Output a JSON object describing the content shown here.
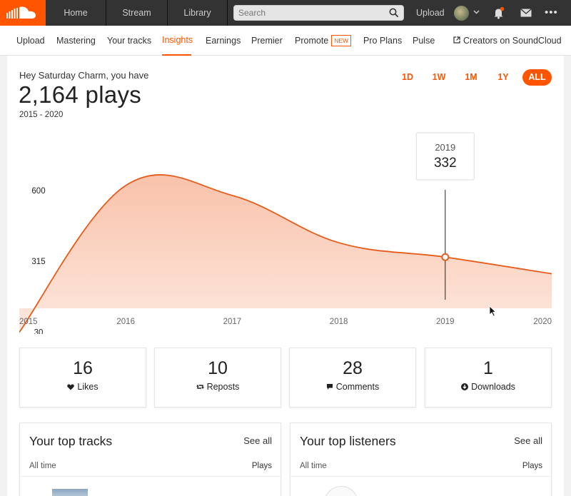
{
  "topbar": {
    "tabs": [
      "Home",
      "Stream",
      "Library"
    ],
    "search_placeholder": "Search",
    "upload_label": "Upload",
    "more_label": "•••"
  },
  "subnav": {
    "items": [
      "Upload",
      "Mastering",
      "Your tracks",
      "Insights",
      "Earnings",
      "Premier",
      "Promote",
      "Pro Plans",
      "Pulse"
    ],
    "active": "Insights",
    "new_badge": "NEW",
    "creators_link": "Creators on SoundCloud"
  },
  "header": {
    "greeting": "Hey Saturday Charm, you have",
    "plays": "2,164 plays",
    "range": "2015 - 2020"
  },
  "range_buttons": [
    "1D",
    "1W",
    "1M",
    "1Y",
    "ALL"
  ],
  "range_active": "ALL",
  "chart_data": {
    "type": "area",
    "x": [
      2015,
      2016,
      2017,
      2018,
      2019,
      2020
    ],
    "xtick_labels": [
      "2015",
      "2016",
      "2017",
      "2018",
      "2019",
      "2020"
    ],
    "ytick_labels": [
      "600",
      "315",
      "30"
    ],
    "ytick_values": [
      600,
      315,
      30
    ],
    "series": [
      {
        "values": [
          30,
          620,
          580,
          390,
          332,
          265
        ]
      }
    ],
    "tooltip": {
      "label": "2019",
      "value": "332"
    },
    "accent": "#ff5500"
  },
  "stats": [
    {
      "value": "16",
      "label": "Likes",
      "icon": "heart-icon"
    },
    {
      "value": "10",
      "label": "Reposts",
      "icon": "repost-icon"
    },
    {
      "value": "28",
      "label": "Comments",
      "icon": "comment-icon"
    },
    {
      "value": "1",
      "label": "Downloads",
      "icon": "download-icon"
    }
  ],
  "top_tracks": {
    "title": "Your top tracks",
    "see_all": "See all",
    "period": "All time",
    "plays_header": "Plays"
  },
  "top_listeners": {
    "title": "Your top listeners",
    "see_all": "See all",
    "period": "All time",
    "plays_header": "Plays"
  }
}
